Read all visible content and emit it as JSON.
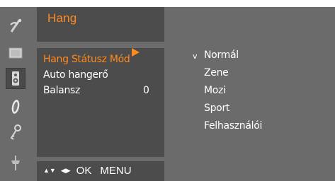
{
  "menu": {
    "title": "Hang",
    "items": [
      {
        "label": "Hang Státusz Mód",
        "value": "",
        "selected": true
      },
      {
        "label": "Auto hangerő",
        "value": "",
        "selected": false
      },
      {
        "label": "Balansz",
        "value": "0",
        "selected": false
      }
    ],
    "footer": {
      "updown_glyph": "▲▼",
      "leftright_glyph": "◀▶",
      "ok_label": "OK",
      "menu_label": "MENU"
    }
  },
  "submenu": {
    "check_mark": "v",
    "selected_index": 0,
    "options": [
      "Normál",
      "Zene",
      "Mozi",
      "Sport",
      "Felhasználói"
    ]
  },
  "sidebar": {
    "icons": [
      "satellite-dish-icon",
      "picture-icon",
      "speaker-icon",
      "clock-icon",
      "key-icon",
      "plug-icon"
    ],
    "active_index": 2
  },
  "colors": {
    "accent": "#ff8a1e",
    "panel": "#4c4c4c",
    "frame": "#6b6b6b",
    "text": "#ffffff"
  }
}
